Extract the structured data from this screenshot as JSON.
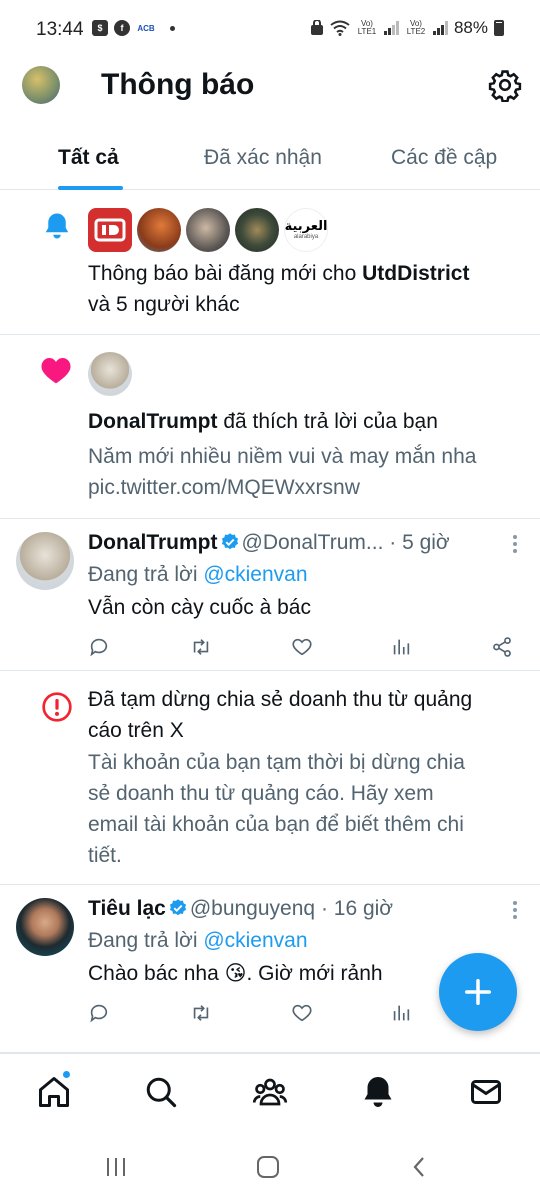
{
  "status_bar": {
    "time": "13:44",
    "signal1_label": "Vo) LTE1",
    "signal2_label": "Vo) LTE2",
    "battery": "88%",
    "icons": [
      "sim-app-icon",
      "facebook-icon",
      "acb-icon",
      "notification-dot"
    ]
  },
  "header": {
    "title": "Thông báo",
    "settings_icon": "gear-icon"
  },
  "tabs": [
    {
      "label": "Tất cả",
      "active": true
    },
    {
      "label": "Đã xác nhận",
      "active": false
    },
    {
      "label": "Các đề cập",
      "active": false
    }
  ],
  "notifications": {
    "post_alert": {
      "text_prefix": "Thông báo bài đăng mới cho ",
      "account": "UtdDistrict",
      "text_suffix": "và 5 người khác",
      "alarabiya_label": "alarabiya"
    },
    "like": {
      "user": "DonalTrumpt",
      "action": " đã thích trả lời của bạn",
      "quote_line1": "Năm mới nhiều niềm vui và may mắn nha",
      "quote_line2": "pic.twitter.com/MQEWxxrsnw"
    },
    "reply1": {
      "name": "DonalTrumpt",
      "handle": "@DonalTrum...",
      "time": "· 5 giờ",
      "replying_prefix": "Đang trả lời ",
      "replying_to": "@ckienvan",
      "content": "Vẫn còn cày cuốc à bác"
    },
    "alert": {
      "title_line1": "Đã tạm dừng chia sẻ doanh thu từ quảng",
      "title_line2": "cáo trên X",
      "body_line1": "Tài khoản của bạn tạm thời bị dừng chia",
      "body_line2": "sẻ doanh thu từ quảng cáo. Hãy xem",
      "body_line3": "email tài khoản của bạn để biết thêm chi",
      "body_line4": "tiết."
    },
    "reply2": {
      "name": "Tiêu lạc",
      "handle": "@bunguyenq",
      "time": "· 16 giờ",
      "replying_prefix": "Đang trả lời ",
      "replying_to": "@ckienvan",
      "content_prefix": "Chào bác nha ",
      "emoji": "😘",
      "content_suffix": ". Giờ mới rảnh"
    }
  },
  "colors": {
    "accent": "#1d9bf0",
    "like": "#f91880",
    "alert": "#f4212e",
    "text": "#0f1419",
    "secondary": "#536471"
  },
  "bottom_nav": [
    "home-icon",
    "search-icon",
    "communities-icon",
    "notifications-icon",
    "messages-icon"
  ]
}
